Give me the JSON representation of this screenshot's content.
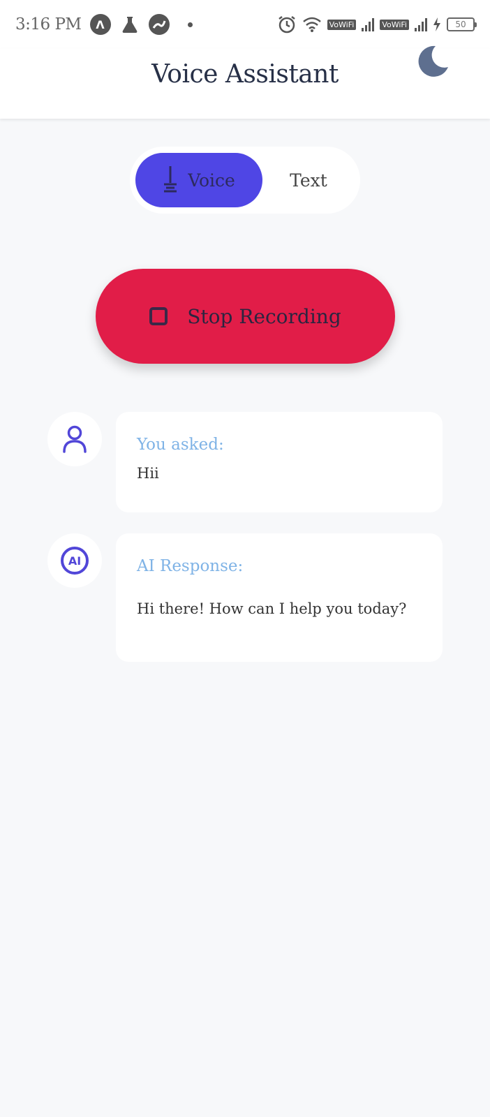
{
  "status_bar": {
    "time": "3:16 PM",
    "vowifi_1": "VoWiFi",
    "vowifi_2": "VoWiFi",
    "battery": "50"
  },
  "header": {
    "title": "Voice Assistant"
  },
  "mode_switch": {
    "voice_label": "Voice",
    "text_label": "Text",
    "active": "Voice"
  },
  "record_button": {
    "label": "Stop Recording"
  },
  "conversation": {
    "user_label": "You asked:",
    "user_message": "Hii",
    "ai_badge": "AI",
    "ai_label": "AI Response:",
    "ai_message": "Hi there! How can I help you today?"
  },
  "colors": {
    "accent": "#4f46e5",
    "record": "#e11d48",
    "label": "#7fb3e6",
    "background": "#f7f8fa"
  }
}
